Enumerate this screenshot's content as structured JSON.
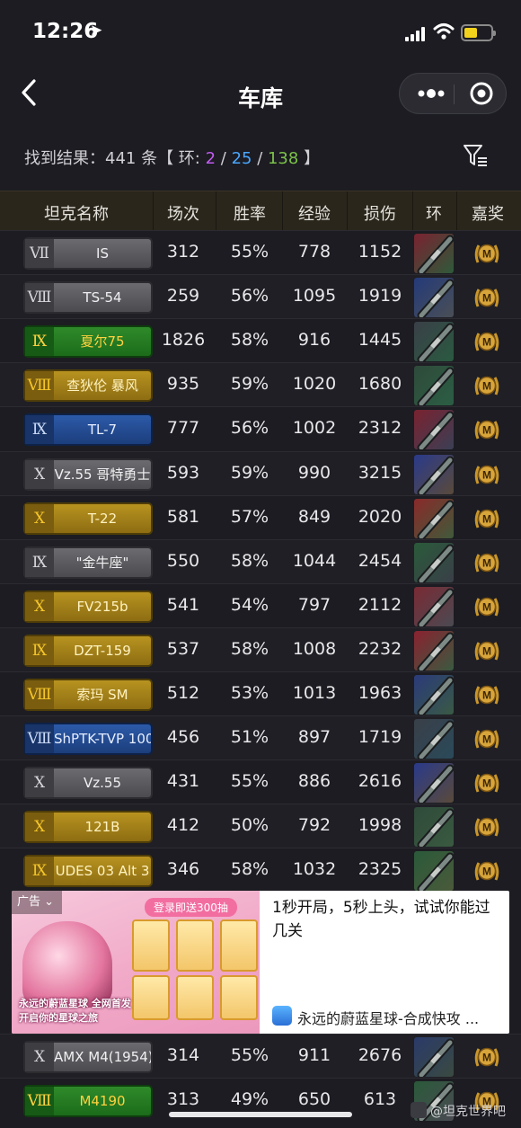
{
  "status_bar": {
    "time": "12:26"
  },
  "nav": {
    "title": "车库"
  },
  "results": {
    "prefix": "找到结果：441 条【 环: ",
    "ring_a": "2",
    "sep1": " / ",
    "ring_b": "25",
    "sep2": " / ",
    "ring_c": "138",
    "suffix": " 】"
  },
  "table": {
    "headers": [
      "坦克名称",
      "场次",
      "胜率",
      "经验",
      "损伤",
      "环",
      "嘉奖"
    ],
    "rows": [
      {
        "tier": "Ⅶ",
        "name": "IS",
        "style": "gray",
        "battles": "312",
        "winrate": "55%",
        "exp": "778",
        "damage": "1152"
      },
      {
        "tier": "Ⅷ",
        "name": "TS-54",
        "style": "gray",
        "battles": "259",
        "winrate": "56%",
        "exp": "1095",
        "damage": "1919"
      },
      {
        "tier": "Ⅸ",
        "name": "夏尔75",
        "style": "green",
        "battles": "1826",
        "winrate": "58%",
        "exp": "916",
        "damage": "1445"
      },
      {
        "tier": "Ⅷ",
        "name": "查狄伦 暴风",
        "style": "gold",
        "battles": "935",
        "winrate": "59%",
        "exp": "1020",
        "damage": "1680"
      },
      {
        "tier": "Ⅸ",
        "name": "TL-7",
        "style": "blue",
        "battles": "777",
        "winrate": "56%",
        "exp": "1002",
        "damage": "2312"
      },
      {
        "tier": "Ⅹ",
        "name": "Vz.55 哥特勇士",
        "style": "gray",
        "battles": "593",
        "winrate": "59%",
        "exp": "990",
        "damage": "3215"
      },
      {
        "tier": "Ⅹ",
        "name": "T-22",
        "style": "gold",
        "battles": "581",
        "winrate": "57%",
        "exp": "849",
        "damage": "2020"
      },
      {
        "tier": "Ⅸ",
        "name": "\"金牛座\"",
        "style": "gray",
        "battles": "550",
        "winrate": "58%",
        "exp": "1044",
        "damage": "2454"
      },
      {
        "tier": "Ⅹ",
        "name": "FV215b",
        "style": "gold",
        "battles": "541",
        "winrate": "54%",
        "exp": "797",
        "damage": "2112"
      },
      {
        "tier": "Ⅸ",
        "name": "DZT-159",
        "style": "gold",
        "battles": "537",
        "winrate": "58%",
        "exp": "1008",
        "damage": "2232"
      },
      {
        "tier": "Ⅷ",
        "name": "索玛 SM",
        "style": "gold",
        "battles": "512",
        "winrate": "53%",
        "exp": "1013",
        "damage": "1963"
      },
      {
        "tier": "Ⅷ",
        "name": "ShPTK-TVP 100",
        "style": "blue",
        "battles": "456",
        "winrate": "51%",
        "exp": "897",
        "damage": "1719"
      },
      {
        "tier": "Ⅹ",
        "name": "Vz.55",
        "style": "gray",
        "battles": "431",
        "winrate": "55%",
        "exp": "886",
        "damage": "2616"
      },
      {
        "tier": "Ⅹ",
        "name": "121B",
        "style": "gold",
        "battles": "412",
        "winrate": "50%",
        "exp": "792",
        "damage": "1998"
      },
      {
        "tier": "Ⅸ",
        "name": "UDES 03 Alt 3",
        "style": "gold",
        "battles": "346",
        "winrate": "58%",
        "exp": "1032",
        "damage": "2325"
      }
    ],
    "rows_after_ad": [
      {
        "tier": "Ⅹ",
        "name": "AMX M4(1954)",
        "style": "gray",
        "battles": "314",
        "winrate": "55%",
        "exp": "911",
        "damage": "2676"
      },
      {
        "tier": "Ⅷ",
        "name": "M4190",
        "style": "green",
        "battles": "313",
        "winrate": "49%",
        "exp": "650",
        "damage": "613"
      }
    ]
  },
  "ad": {
    "tag": "广告",
    "banner": "登录即送300抽",
    "slogan_line1": "永远的蔚蓝星球 全网首发",
    "slogan_line2": "开启你的星球之旅",
    "description": "1秒开局，5秒上头，试试你能过几关",
    "app_name": "永远的蔚蓝星球-合成快攻 ..."
  },
  "watermark": {
    "text": "@坦克世界吧"
  },
  "medal_letter": "M",
  "colors": {
    "ring_purple": "#c15bf0",
    "ring_blue": "#4aa6ff",
    "ring_green": "#7cc24a",
    "background": "#1c1c22"
  }
}
